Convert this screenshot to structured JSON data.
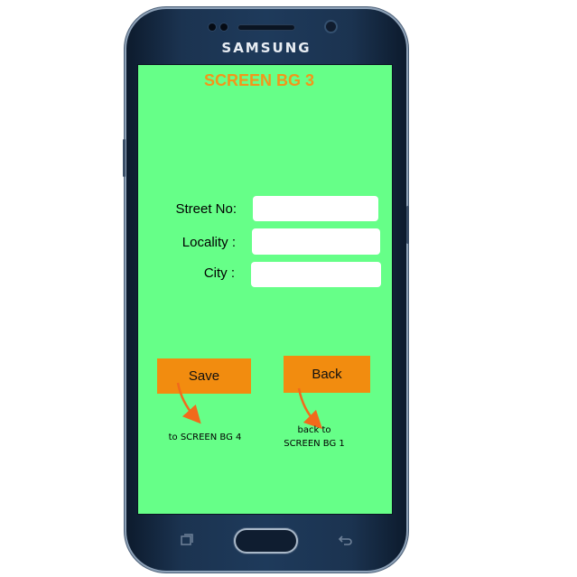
{
  "device": {
    "brand": "SAMSUNG"
  },
  "screen": {
    "title": "SCREEN BG 3",
    "background_color": "#66ff88",
    "form": {
      "street_label": "Street No:",
      "street_value": "",
      "locality_label": "Locality :",
      "locality_value": "",
      "city_label": "City :",
      "city_value": ""
    },
    "buttons": {
      "save_label": "Save",
      "back_label": "Back",
      "button_color": "#f28c0f"
    },
    "annotations": {
      "save_note": "to SCREEN BG 4",
      "back_note_line1": "back to",
      "back_note_line2": "SCREEN BG 1",
      "arrow_color": "#f26a1b"
    }
  },
  "nav": {
    "recent_icon": "recent-apps-icon",
    "home_icon": "home-button",
    "back_icon": "back-arrow-icon"
  }
}
